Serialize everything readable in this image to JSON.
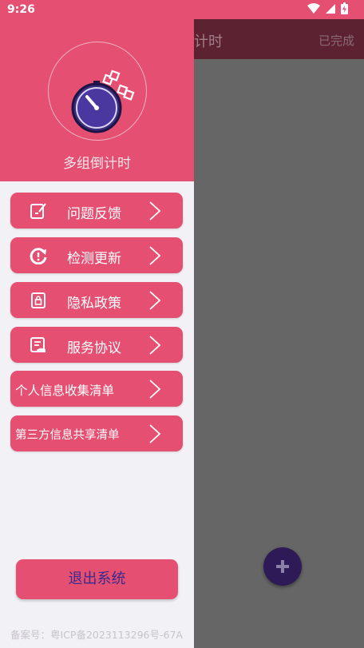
{
  "status_bar": {
    "time": "9:26"
  },
  "background": {
    "title_fragment": "计时",
    "done_label": "已完成"
  },
  "drawer": {
    "app_name": "多组倒计时",
    "menu": [
      {
        "label": "问题反馈",
        "icon": "feedback-icon"
      },
      {
        "label": "检测更新",
        "icon": "update-icon"
      },
      {
        "label": "隐私政策",
        "icon": "privacy-icon"
      },
      {
        "label": "服务协议",
        "icon": "agreement-icon"
      },
      {
        "label": "个人信息收集清单",
        "icon": ""
      },
      {
        "label": "第三方信息共享清单",
        "icon": ""
      }
    ],
    "logout_label": "退出系统",
    "icp": "备案号：粤ICP备2023113296号-67A"
  },
  "colors": {
    "accent": "#e44f72",
    "logout_text": "#3b2a8a",
    "fab": "#2d1a57"
  }
}
